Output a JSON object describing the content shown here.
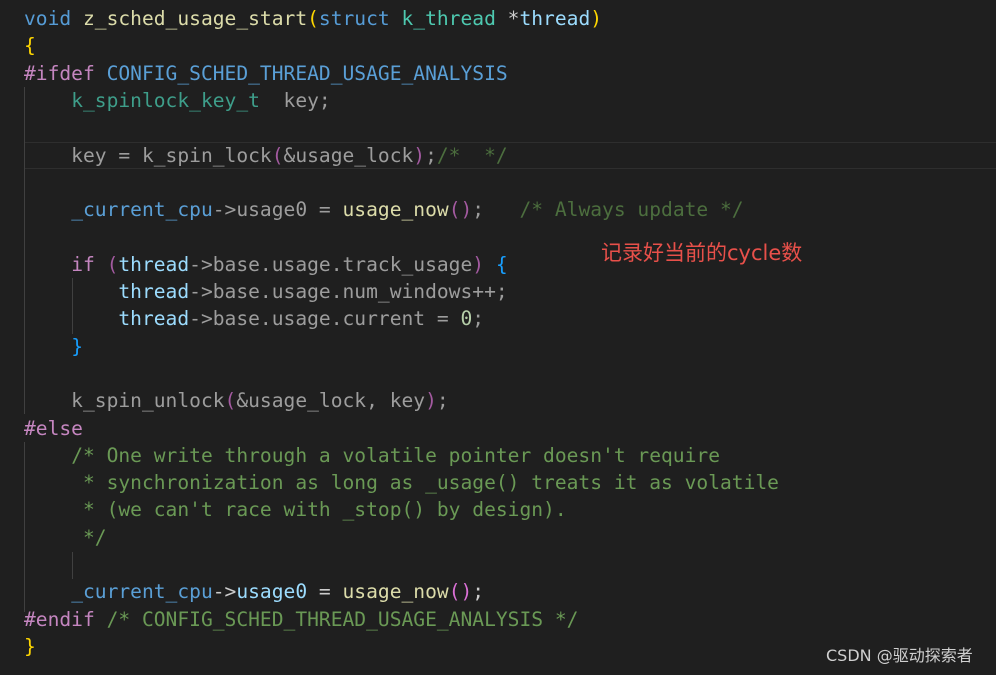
{
  "code": {
    "lines": [
      [
        [
          "kw",
          "void"
        ],
        [
          "tx",
          " "
        ],
        [
          "fn",
          "z_sched_usage_start"
        ],
        [
          "b1",
          "("
        ],
        [
          "kw",
          "struct"
        ],
        [
          "tx",
          " "
        ],
        [
          "ty",
          "k_thread"
        ],
        [
          "tx",
          " *"
        ],
        [
          "va",
          "thread"
        ],
        [
          "b1",
          ")"
        ]
      ],
      [
        [
          "b1",
          "{"
        ]
      ],
      [
        [
          "pp",
          "#ifdef"
        ],
        [
          "tx",
          " "
        ],
        [
          "mc",
          "CONFIG_SCHED_THREAD_USAGE_ANALYSIS"
        ]
      ],
      [
        [
          "tx",
          "    "
        ],
        [
          "tt",
          "k_spinlock_key_t"
        ],
        [
          "dm",
          "  key;"
        ]
      ],
      [],
      [
        [
          "dm",
          "    key = k_spin_lock"
        ],
        [
          "b2d",
          "("
        ],
        [
          "dm",
          "&usage_lock"
        ],
        [
          "b2d",
          ")"
        ],
        [
          "dm",
          ";"
        ],
        [
          "cd",
          "/*  */"
        ]
      ],
      [],
      [
        [
          "tx",
          "    "
        ],
        [
          "mc",
          "_current_cpu"
        ],
        [
          "dm",
          "->usage0 = "
        ],
        [
          "fn",
          "usage_now"
        ],
        [
          "b2d",
          "()"
        ],
        [
          "dm",
          ";   "
        ],
        [
          "cd",
          "/* Always update */"
        ]
      ],
      [],
      [
        [
          "tx",
          "    "
        ],
        [
          "pp",
          "if"
        ],
        [
          "tx",
          " "
        ],
        [
          "b2d",
          "("
        ],
        [
          "va",
          "thread"
        ],
        [
          "dm",
          "->base.usage.track_usage"
        ],
        [
          "b2d",
          ")"
        ],
        [
          "tx",
          " "
        ],
        [
          "b3",
          "{"
        ]
      ],
      [
        [
          "tx",
          "        "
        ],
        [
          "va",
          "thread"
        ],
        [
          "dm",
          "->base.usage.num_windows++;"
        ]
      ],
      [
        [
          "tx",
          "        "
        ],
        [
          "va",
          "thread"
        ],
        [
          "dm",
          "->base.usage.current = "
        ],
        [
          "nm",
          "0"
        ],
        [
          "dm",
          ";"
        ]
      ],
      [
        [
          "tx",
          "    "
        ],
        [
          "b3",
          "}"
        ]
      ],
      [],
      [
        [
          "dm",
          "    k_spin_unlock"
        ],
        [
          "b2d",
          "("
        ],
        [
          "dm",
          "&usage_lock, key"
        ],
        [
          "b2d",
          ")"
        ],
        [
          "dm",
          ";"
        ]
      ],
      [
        [
          "pp",
          "#else"
        ]
      ],
      [
        [
          "tx",
          "    "
        ],
        [
          "cm",
          "/* One write through a volatile pointer doesn't require"
        ]
      ],
      [
        [
          "tx",
          "     "
        ],
        [
          "cm",
          "* synchronization as long as _usage() treats it as volatile"
        ]
      ],
      [
        [
          "tx",
          "     "
        ],
        [
          "cm",
          "* (we can't race with _stop() by design)."
        ]
      ],
      [
        [
          "tx",
          "     "
        ],
        [
          "cm",
          "*/"
        ]
      ],
      [],
      [
        [
          "tx",
          "    "
        ],
        [
          "mc",
          "_current_cpu"
        ],
        [
          "tx",
          "->"
        ],
        [
          "va",
          "usage0"
        ],
        [
          "tx",
          " = "
        ],
        [
          "fn",
          "usage_now"
        ],
        [
          "b2",
          "()"
        ],
        [
          "tx",
          ";"
        ]
      ],
      [
        [
          "pp",
          "#endif"
        ],
        [
          "tx",
          " "
        ],
        [
          "cm",
          "/* CONFIG_SCHED_THREAD_USAGE_ANALYSIS */"
        ]
      ],
      [
        [
          "b1",
          "}"
        ]
      ]
    ]
  },
  "annotation": "记录好当前的cycle数",
  "watermark": "CSDN @驱动探索者",
  "colors": {
    "background": "#1f1f1f",
    "keyword": "#569cd6",
    "function": "#dcdcaa",
    "comment": "#6a9955",
    "annotation": "#e8504a"
  }
}
